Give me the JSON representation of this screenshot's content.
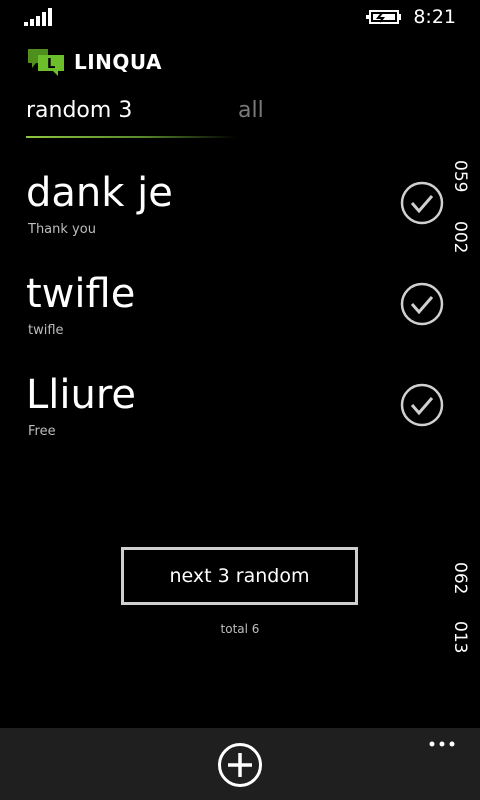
{
  "status_bar": {
    "time": "8:21"
  },
  "app": {
    "title": "LINQUA",
    "logo_letter": "L",
    "logo_color": "#6cbe2b"
  },
  "pivot": {
    "tabs": [
      {
        "label": "random 3",
        "active": true
      },
      {
        "label": "all",
        "active": false
      }
    ]
  },
  "words": [
    {
      "word": "dank je",
      "translation": "Thank you"
    },
    {
      "word": "twifle",
      "translation": "twifle"
    },
    {
      "word": "Lliure",
      "translation": "Free"
    }
  ],
  "side_numbers": [
    "059",
    "002",
    "062",
    "013"
  ],
  "next_button": {
    "label": "next 3 random"
  },
  "total_label": "total 6",
  "colors": {
    "background": "#000000",
    "accent": "#8fc640",
    "app_bar": "#1f1f1f"
  },
  "icons": {
    "add": "add-circle-icon",
    "check": "check-circle-icon",
    "more": "more-ellipsis-icon"
  }
}
